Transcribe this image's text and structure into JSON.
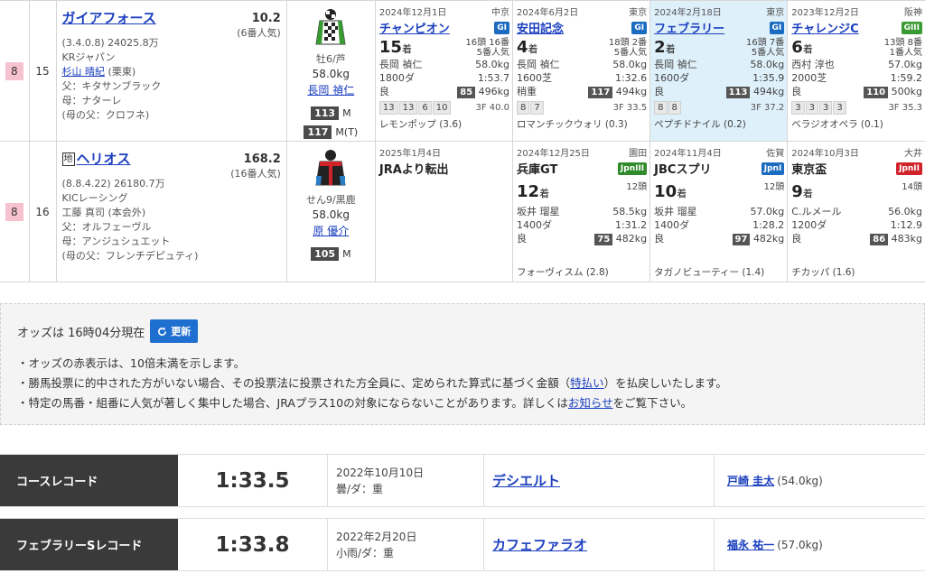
{
  "horses": [
    {
      "waku": "8",
      "num": "15",
      "chihou": "",
      "name": "ガイアフォース",
      "odds": "10.2",
      "popularity": "(6番人気)",
      "birth_prize": "(3.4.0.8)  24025.8万",
      "owner": "KRジャパン",
      "trainer": "杉山 晴紀",
      "trainer_region": "(栗東)",
      "sire": "父：キタサンブラック",
      "dam": "母：ナターレ",
      "broodsire": "(母の父：クロフネ)",
      "sex_age": "牡6/芦",
      "weight_carried": "58.0kg",
      "jockey": "長岡 禎仁",
      "rating1": "113",
      "rating1_label": "M",
      "rating2": "117",
      "rating2_label": "M(T)",
      "races": [
        {
          "date": "2024年12月1日",
          "track": "中京",
          "name": "チャンピオン",
          "grade": "GI",
          "grade_class": "g-blue",
          "place": "15",
          "place_unit": "着",
          "heads": "16頭 16番",
          "pop": "5番人気",
          "jockey": "長岡 禎仁",
          "kg": "58.0kg",
          "dist": "1800ダ",
          "time": "1:53.7",
          "cond": "良",
          "rate": "85",
          "bw": "496kg",
          "chips": [
            "13",
            "13",
            "6",
            "10"
          ],
          "last3f": "3F 40.0",
          "winner": "レモンポップ (3.6)",
          "hl": false
        },
        {
          "date": "2024年6月2日",
          "track": "東京",
          "name": "安田記念",
          "grade": "GI",
          "grade_class": "g-blue",
          "place": "4",
          "place_unit": "着",
          "heads": "18頭 2番",
          "pop": "5番人気",
          "jockey": "長岡 禎仁",
          "kg": "58.0kg",
          "dist": "1600芝",
          "time": "1:32.6",
          "cond": "稍重",
          "rate": "117",
          "bw": "494kg",
          "chips": [
            "8",
            "7"
          ],
          "last3f": "3F 33.5",
          "winner": "ロマンチックウォリ (0.3)",
          "hl": false
        },
        {
          "date": "2024年2月18日",
          "track": "東京",
          "name": "フェブラリー",
          "grade": "GI",
          "grade_class": "g-blue",
          "place": "2",
          "place_unit": "着",
          "heads": "16頭 7番",
          "pop": "5番人気",
          "jockey": "長岡 禎仁",
          "kg": "58.0kg",
          "dist": "1600ダ",
          "time": "1:35.9",
          "cond": "良",
          "rate": "113",
          "bw": "494kg",
          "chips": [
            "8",
            "8"
          ],
          "last3f": "3F 37.2",
          "winner": "ペプチドナイル (0.2)",
          "hl": true
        },
        {
          "date": "2023年12月2日",
          "track": "阪神",
          "name": "チャレンジC",
          "grade": "GIII",
          "grade_class": "g-green",
          "place": "6",
          "place_unit": "着",
          "heads": "13頭 8番",
          "pop": "1番人気",
          "jockey": "西村 淳也",
          "kg": "57.0kg",
          "dist": "2000芝",
          "time": "1:59.2",
          "cond": "良",
          "rate": "110",
          "bw": "500kg",
          "chips": [
            "3",
            "3",
            "3",
            "3"
          ],
          "last3f": "3F 35.3",
          "winner": "ベラジオオペラ (0.1)",
          "hl": false
        }
      ]
    },
    {
      "waku": "8",
      "num": "16",
      "chihou": "地",
      "name": "ヘリオス",
      "odds": "168.2",
      "popularity": "(16番人気)",
      "birth_prize": "(8.8.4.22)  26180.7万",
      "owner": "KICレーシング",
      "trainer": "工藤 真司",
      "trainer_region": "(本会外)",
      "sire": "父：オルフェーヴル",
      "dam": "母：アンジュシュエット",
      "broodsire": "(母の父：フレンチデピュティ)",
      "sex_age": "せん9/黒鹿",
      "weight_carried": "58.0kg",
      "jockey": "原 優介",
      "rating1": "105",
      "rating1_label": "M",
      "races": [
        {
          "date": "2025年1月4日",
          "track": "",
          "name": "JRAより転出",
          "plain": true
        },
        {
          "date": "2024年12月25日",
          "track": "園田",
          "name": "兵庫GT",
          "grade": "JpnIII",
          "grade_class": "g-jpn3",
          "place": "12",
          "place_unit": "着",
          "heads": "12頭",
          "jockey": "坂井 瑠星",
          "kg": "58.5kg",
          "dist": "1400ダ",
          "time": "1:31.2",
          "cond": "良",
          "rate": "75",
          "bw": "482kg",
          "winner": "フォーヴィスム (2.8)"
        },
        {
          "date": "2024年11月4日",
          "track": "佐賀",
          "name": "JBCスプリ",
          "grade": "JpnI",
          "grade_class": "g-jpn1",
          "place": "10",
          "place_unit": "着",
          "heads": "12頭",
          "jockey": "坂井 瑠星",
          "kg": "57.0kg",
          "dist": "1400ダ",
          "time": "1:28.2",
          "cond": "良",
          "rate": "97",
          "bw": "482kg",
          "winner": "タガノビューティー (1.4)"
        },
        {
          "date": "2024年10月3日",
          "track": "大井",
          "name": "東京盃",
          "grade": "JpnII",
          "grade_class": "g-jpn2",
          "place": "9",
          "place_unit": "着",
          "heads": "14頭",
          "jockey": "C.ルメール",
          "kg": "56.0kg",
          "dist": "1200ダ",
          "time": "1:12.9",
          "cond": "良",
          "rate": "86",
          "bw": "483kg",
          "winner": "チカッパ (1.6)"
        }
      ]
    }
  ],
  "odds": {
    "time_text": "オッズは 16時04分現在",
    "refresh_label": "更新",
    "note1": "・オッズの赤表示は、10倍未満を示します。",
    "note2_pre": "・勝馬投票に的中された方がいない場合、その投票法に投票された方全員に、定められた算式に基づく金額（",
    "note2_link": "特払い",
    "note2_post": "）を払戻しいたします。",
    "note3_pre": "・特定の馬番・組番に人気が著しく集中した場合、JRAプラス10の対象にならないことがあります。詳しくは",
    "note3_link": "お知らせ",
    "note3_post": "をご覧下さい。"
  },
  "records": [
    {
      "label": "コースレコード",
      "time": "1:33.5",
      "date": "2022年10月10日",
      "cond": "曇/ダ：重",
      "horse": "デシエルト",
      "jockey": "戸崎 圭太",
      "kg": "(54.0kg)"
    },
    {
      "label": "フェブラリーSレコード",
      "time": "1:33.8",
      "date": "2022年2月20日",
      "cond": "小雨/ダ：重",
      "horse": "カフェファラオ",
      "jockey": "福永 祐一",
      "kg": "(57.0kg)"
    }
  ],
  "colors": {
    "waku8": "#f7c2d0",
    "link": "#1b3fbf",
    "highlight": "#def0fa",
    "refresh": "#1f6fd0",
    "record_label_bg": "#3a3a3a"
  }
}
